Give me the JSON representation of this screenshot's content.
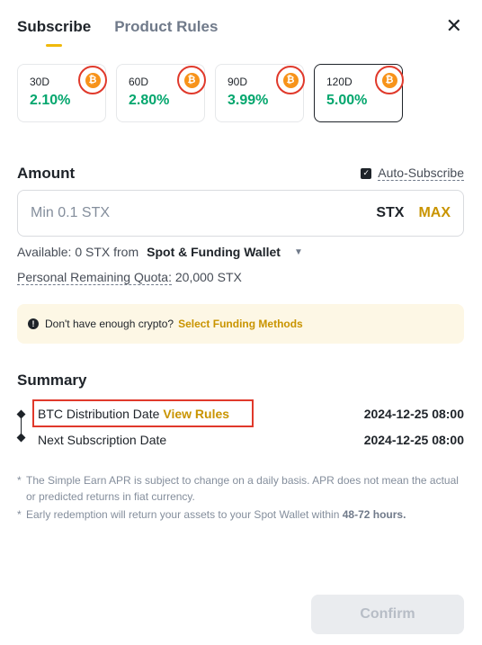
{
  "tabs": [
    "Subscribe",
    "Product Rules"
  ],
  "close_label": "✕",
  "durations": [
    {
      "days": "30D",
      "apr": "2.10%",
      "active": false
    },
    {
      "days": "60D",
      "apr": "2.80%",
      "active": false
    },
    {
      "days": "90D",
      "apr": "3.99%",
      "active": false
    },
    {
      "days": "120D",
      "apr": "5.00%",
      "active": true
    }
  ],
  "coin_symbol": "₿",
  "amount": {
    "label": "Amount",
    "auto_subscribe": "Auto-Subscribe",
    "placeholder": "Min 0.1 STX",
    "unit": "STX",
    "max": "MAX"
  },
  "available": {
    "text": "Available: 0 STX from",
    "wallet": "Spot & Funding Wallet"
  },
  "quota": {
    "label": "Personal Remaining Quota:",
    "value": "20,000 STX"
  },
  "notice": {
    "text": "Don't have enough crypto?",
    "link": "Select Funding Methods"
  },
  "summary": {
    "title": "Summary",
    "rows": [
      {
        "label": "BTC Distribution Date",
        "link": "View Rules",
        "value": "2024-12-25 08:00"
      },
      {
        "label": "Next Subscription Date",
        "value": "2024-12-25 08:00"
      }
    ]
  },
  "notes": {
    "n1": "The Simple Earn APR is subject to change on a daily basis. APR does not mean the actual or predicted returns in fiat currency.",
    "n2_pre": "Early redemption will return your assets to your Spot Wallet within",
    "n2_bold": "48-72 hours."
  },
  "confirm_label": "Confirm",
  "colors": {
    "accent": "#f0b90b",
    "positive": "#03a66d",
    "link": "#c99400",
    "highlight": "#e0392b",
    "coin": "#f7931a"
  }
}
